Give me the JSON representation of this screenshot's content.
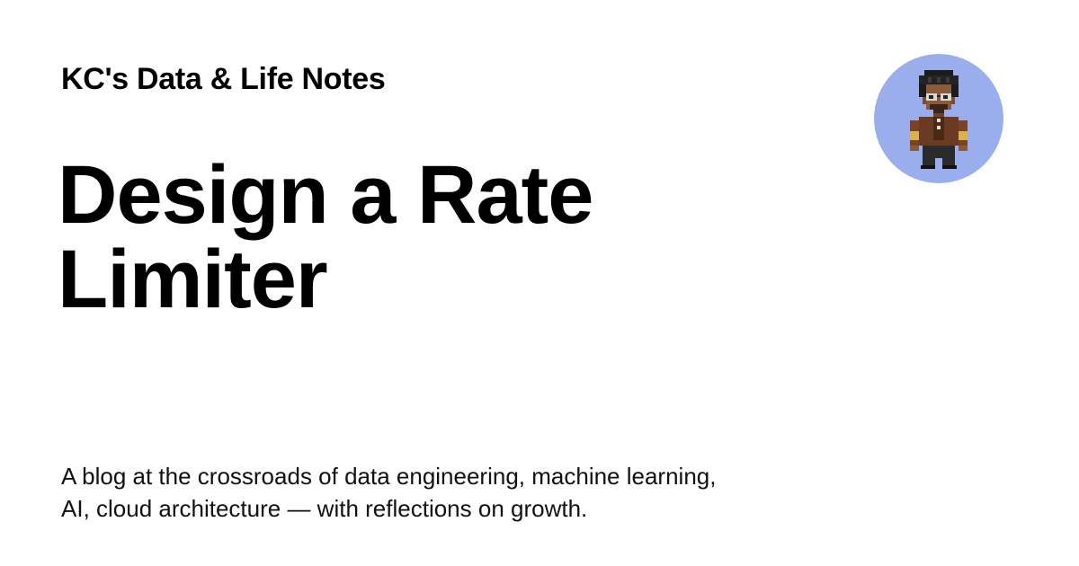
{
  "header": {
    "site_name": "KC's Data & Life Notes"
  },
  "post": {
    "title_line1": "Design a Rate",
    "title_line2": "Limiter"
  },
  "footer": {
    "description_line1": "A blog at the crossroads of data engineering, machine learning,",
    "description_line2": "AI, cloud architecture — with reflections on growth."
  },
  "avatar": {
    "icon": "pixel-character-avatar",
    "background_color": "#9aaeee"
  }
}
